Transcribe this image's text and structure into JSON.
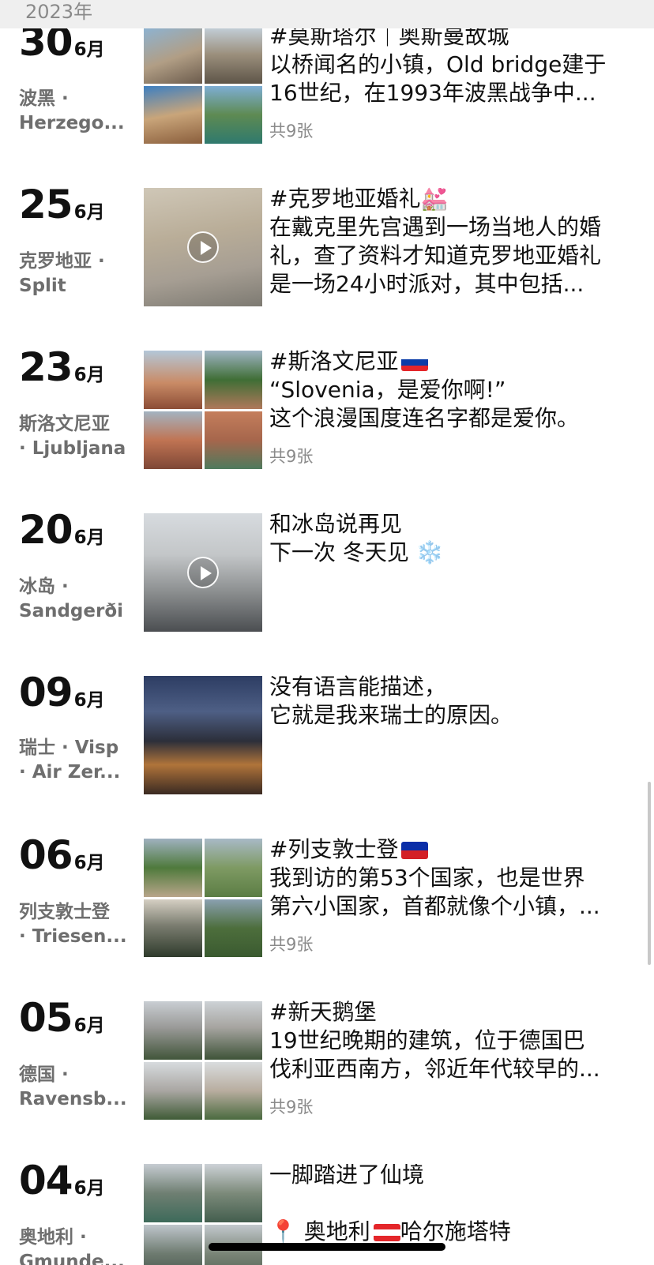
{
  "year_label": "2023年",
  "month_suffix": "6月",
  "count_label": "共9张",
  "entries": [
    {
      "day": "30",
      "loc1": "波黑 ·",
      "loc2": "Herzego...",
      "text": [
        "#莫斯塔尔｜奥斯曼故城",
        "以桥闻名的小镇，Old bridge建于",
        "16世纪，在1993年波黑战争中..."
      ],
      "count": "共9张"
    },
    {
      "day": "25",
      "loc1": "克罗地亚 ·",
      "loc2": "Split",
      "text": [
        "#克罗地亚婚礼💒",
        "在戴克里先宫遇到一场当地人的婚",
        "礼，查了资料才知道克罗地亚婚礼",
        "是一场24小时派对，其中包括..."
      ],
      "count": ""
    },
    {
      "day": "23",
      "loc1": "斯洛文尼亚",
      "loc2": "· Ljubljana",
      "text": [
        "#斯洛文尼亚",
        "“Slovenia，是爱你啊!”",
        "这个浪漫国度连名字都是爱你。"
      ],
      "count": "共9张"
    },
    {
      "day": "20",
      "loc1": "冰岛 ·",
      "loc2": "Sandgerði",
      "text": [
        "和冰岛说再见",
        "下一次 冬天见 ❄️"
      ],
      "count": ""
    },
    {
      "day": "09",
      "loc1": "瑞士 · Visp",
      "loc2": "· Air Zer...",
      "text": [
        "没有语言能描述，",
        "它就是我来瑞士的原因。"
      ],
      "count": ""
    },
    {
      "day": "06",
      "loc1": "列支敦士登",
      "loc2": "· Triesen...",
      "text": [
        "#列支敦士登",
        "我到访的第53个国家，也是世界",
        "第六小国家，首都就像个小镇，..."
      ],
      "count": "共9张"
    },
    {
      "day": "05",
      "loc1": "德国 ·",
      "loc2": "Ravensb...",
      "text": [
        "#新天鹅堡",
        "19世纪晚期的建筑，位于德国巴",
        "伐利亚西南方，邻近年代较早的..."
      ],
      "count": "共9张"
    },
    {
      "day": "04",
      "loc1": "奥地利 ·",
      "loc2": "Gmunde...",
      "text": [
        "一脚踏进了仙境",
        "",
        "📍 奥地利 哈尔施塔特"
      ],
      "count": ""
    }
  ],
  "colors": {
    "flag_slovenia": [
      "#ffffff",
      "#0b3da8",
      "#e4262a"
    ],
    "flag_liechtenstein": [
      "#0b2ea8",
      "#d32027"
    ],
    "flag_austria": [
      "#e4262a",
      "#ffffff",
      "#e4262a"
    ]
  }
}
